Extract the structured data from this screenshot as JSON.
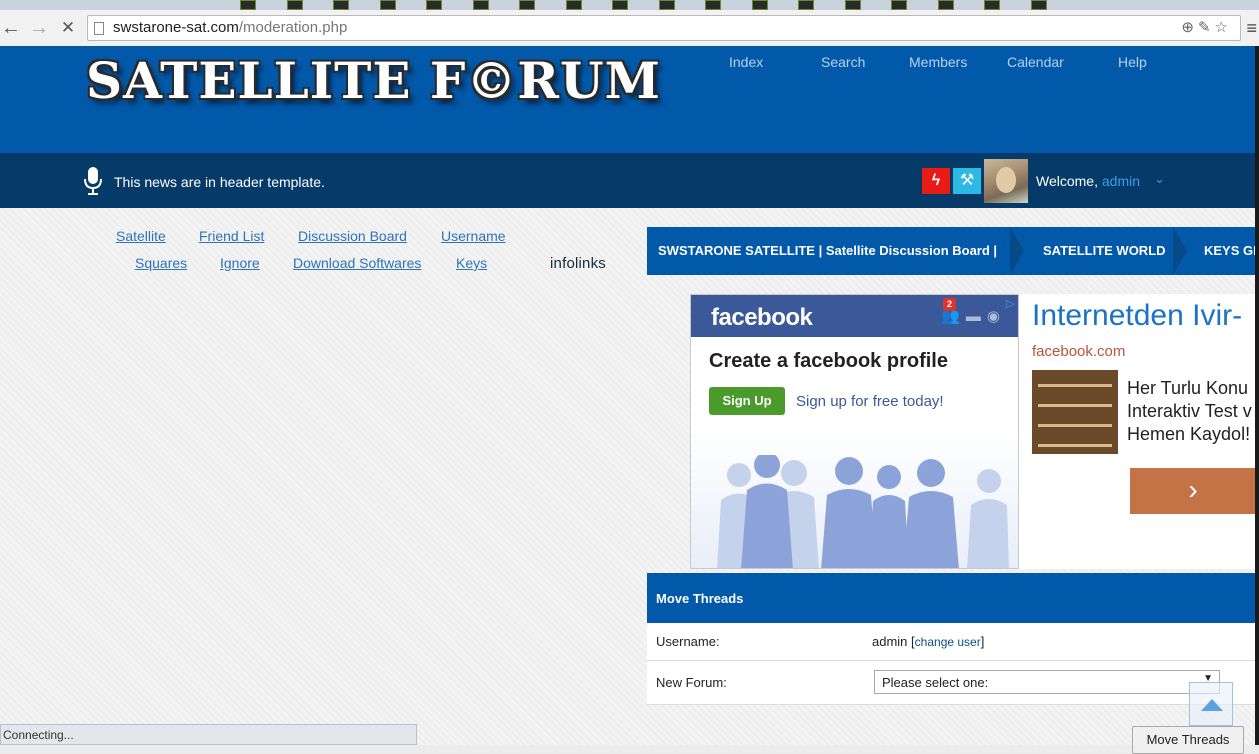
{
  "browser": {
    "url_host": "swstarone-sat.com",
    "url_path": "/moderation.php",
    "status": "Connecting..."
  },
  "header": {
    "logo_text": "SATELLITE F©RUM",
    "nav": [
      "Index",
      "Search",
      "Members",
      "Calendar",
      "Help"
    ]
  },
  "newsbar": {
    "text": "This news are in header template.",
    "welcome_prefix": "Welcome,",
    "username": "admin"
  },
  "links": {
    "row1": [
      "Satellite",
      "Friend List",
      "Discussion Board",
      "Username"
    ],
    "row2": [
      "Squares",
      "Ignore",
      "Download Softwares",
      "Keys"
    ],
    "infolinks": "infolinks"
  },
  "breadcrumb": [
    "SWSTARONE SATELLITE | Satellite Discussion Board |",
    "SATELLITE WORLD",
    "KEYS GE"
  ],
  "ad": {
    "fb_logo": "facebook",
    "fb_notif_count": "2",
    "fb_headline": "Create a facebook profile",
    "fb_signup": "Sign Up",
    "fb_free": "Sign up for free today!",
    "title": "Internetden Ivir-",
    "domain": "facebook.com",
    "desc_lines": [
      "Her Turlu Konu",
      "Interaktiv Test v",
      "Hemen Kaydol!"
    ]
  },
  "move_threads": {
    "title": "Move Threads",
    "username_label": "Username:",
    "username_value": "admin",
    "change_user": "change user",
    "new_forum_label": "New Forum:",
    "select_value": "Please select one:",
    "button": "Move Threads"
  },
  "colors": {
    "header_blue": "#0259a9",
    "newsbar_navy": "#063a69",
    "link_blue": "#2d73b8",
    "facebook_blue": "#3b5998",
    "ad_button": "#c37345"
  }
}
